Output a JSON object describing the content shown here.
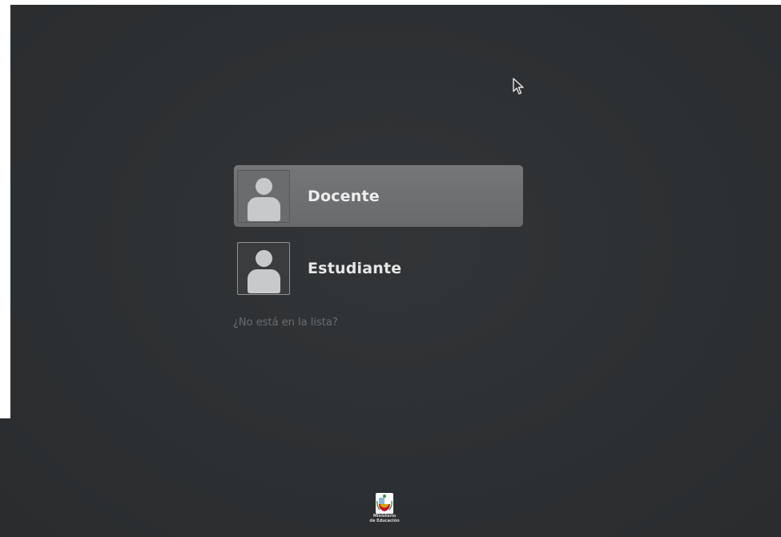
{
  "users": [
    {
      "name": "Docente",
      "selected": true,
      "icon": "user-avatar-icon"
    },
    {
      "name": "Estudiante",
      "selected": false,
      "icon": "user-avatar-icon"
    }
  ],
  "not_listed_link": "¿No está en la lista?",
  "branding": {
    "line1": "Ministerio",
    "line2": "de Educación",
    "icon": "peru-coat-of-arms-icon"
  },
  "colors": {
    "background": "#2c2f31",
    "selected_row": "#6d6f71",
    "text": "#e6e6e6",
    "link": "#6a6d70"
  }
}
